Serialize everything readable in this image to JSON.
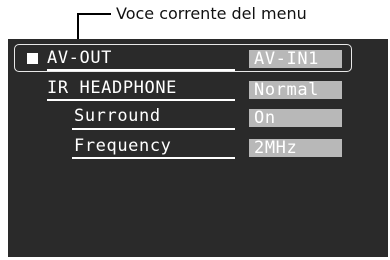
{
  "callout": {
    "text": "Voce corrente del menu"
  },
  "menu": {
    "items": [
      {
        "label": "AV-OUT",
        "value": "AV-IN1",
        "selected": true
      },
      {
        "label": "IR HEADPHONE",
        "value": "Normal",
        "selected": false
      },
      {
        "label": "Surround",
        "value": "On",
        "selected": false
      },
      {
        "label": "Frequency",
        "value": "2MHz",
        "selected": false
      }
    ]
  },
  "colors": {
    "osd_background": "#2a2a2a",
    "value_box": "#b8b8b8",
    "text": "#ffffff"
  }
}
